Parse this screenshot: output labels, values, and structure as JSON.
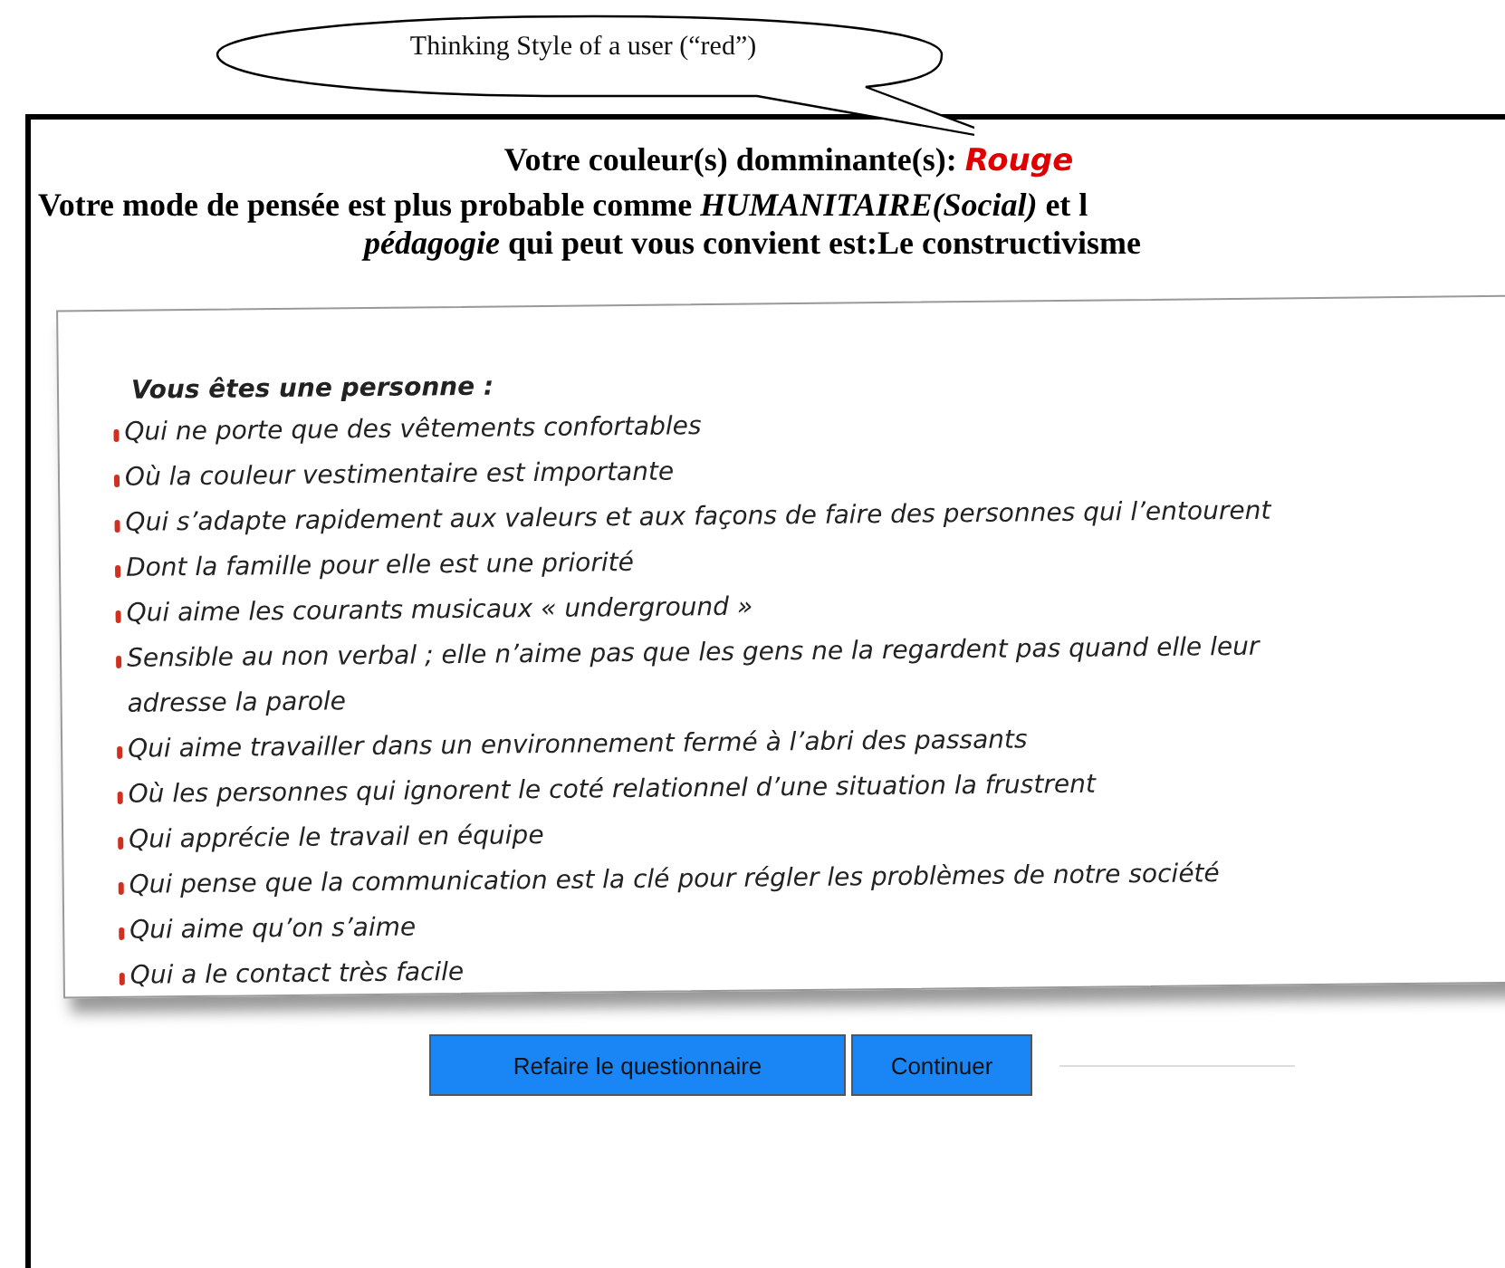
{
  "callout": {
    "text": "Thinking Style of a user (“red”)"
  },
  "heading": {
    "label": "Votre couleur(s) domminante(s):",
    "value": "Rouge"
  },
  "summary": [
    "Votre mode de pensée est plus probable comme *HUMANITAIRE(Social)* et l",
    "*pédagogie* qui peut vous convient est:Le constructivisme"
  ],
  "traits": {
    "title": "Vous êtes une personne :",
    "items": [
      "Qui ne porte que des vêtements confortables",
      "Où la couleur vestimentaire est importante",
      "Qui s’adapte rapidement aux valeurs et aux façons de faire des personnes qui l’entourent",
      "Dont la famille pour elle est une priorité",
      "Qui aime les courants musicaux « underground »",
      "Sensible au non verbal ; elle n’aime pas que les gens ne la regardent pas quand elle leur adresse la parole",
      "Qui aime travailler dans un environnement fermé à l’abri des passants",
      "Où les personnes qui ignorent le coté relationnel d’une situation la frustrent",
      "Qui apprécie le travail en équipe",
      "Qui pense que la communication est la clé pour régler les problèmes de notre société",
      "Qui aime qu’on s’aime",
      "Qui a le contact très facile"
    ]
  },
  "buttons": [
    {
      "label": "Refaire le questionnaire"
    },
    {
      "label": "Continuer"
    }
  ]
}
